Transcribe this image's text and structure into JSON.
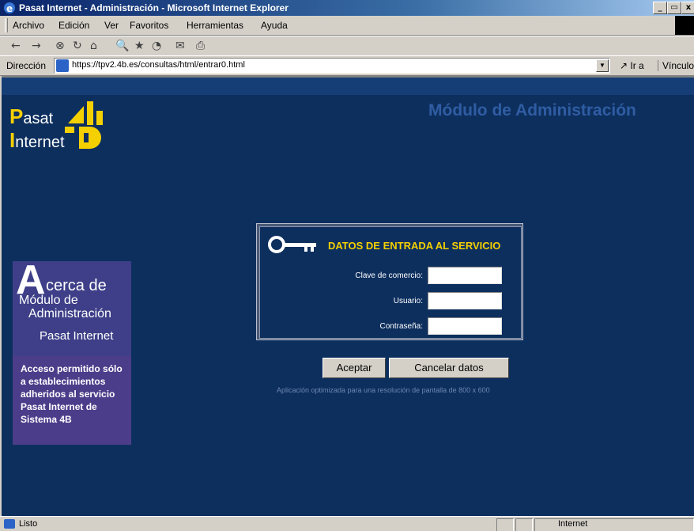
{
  "window": {
    "title": "Pasat Internet - Administración - Microsoft Internet Explorer",
    "controls": {
      "minimize": "_",
      "maximize": "▭",
      "close": "x"
    }
  },
  "menu": {
    "items": [
      "Archivo",
      "Edición",
      "Ver",
      "Favoritos",
      "Herramientas",
      "Ayuda"
    ]
  },
  "toolbar": {
    "back": "←",
    "forward": "→",
    "stop": "⊗",
    "refresh": "↻",
    "home": "⌂",
    "search": "🔍",
    "favorites": "★",
    "history": "◔",
    "mail": "✉",
    "print": "⎙"
  },
  "address": {
    "label": "Dirección",
    "url": "https://tpv2.4b.es/consultas/html/entrar0.html",
    "go_label": "Ir a",
    "links_label": "Vínculo"
  },
  "page": {
    "brand_line1_initial": "P",
    "brand_line1_rest": "asat",
    "brand_line2_initial": "I",
    "brand_line2_rest": "nternet",
    "header": "Módulo de Administración",
    "acerca": {
      "initial": "A",
      "line1": "cerca de",
      "line2": "Módulo de",
      "line3": "Administración",
      "line4": "Pasat Internet"
    },
    "acceso": "Acceso permitido sólo a establecimientos adheridos al servicio Pasat Internet de Sistema 4B",
    "login": {
      "title": "DATOS DE ENTRADA AL SERVICIO",
      "fields": {
        "clave_label": "Clave de comercio:",
        "usuario_label": "Usuario:",
        "password_label": "Contraseña:"
      }
    },
    "buttons": {
      "accept": "Aceptar",
      "cancel": "Cancelar datos"
    },
    "note": "Aplicación optimizada para una resolución de pantalla de 800 x 600"
  },
  "status": {
    "text": "Listo",
    "zone": "Internet"
  },
  "colors": {
    "page_bg": "#0d2f5e",
    "accent_yellow": "#f5d000",
    "panel_purple": "#3e3f88"
  }
}
